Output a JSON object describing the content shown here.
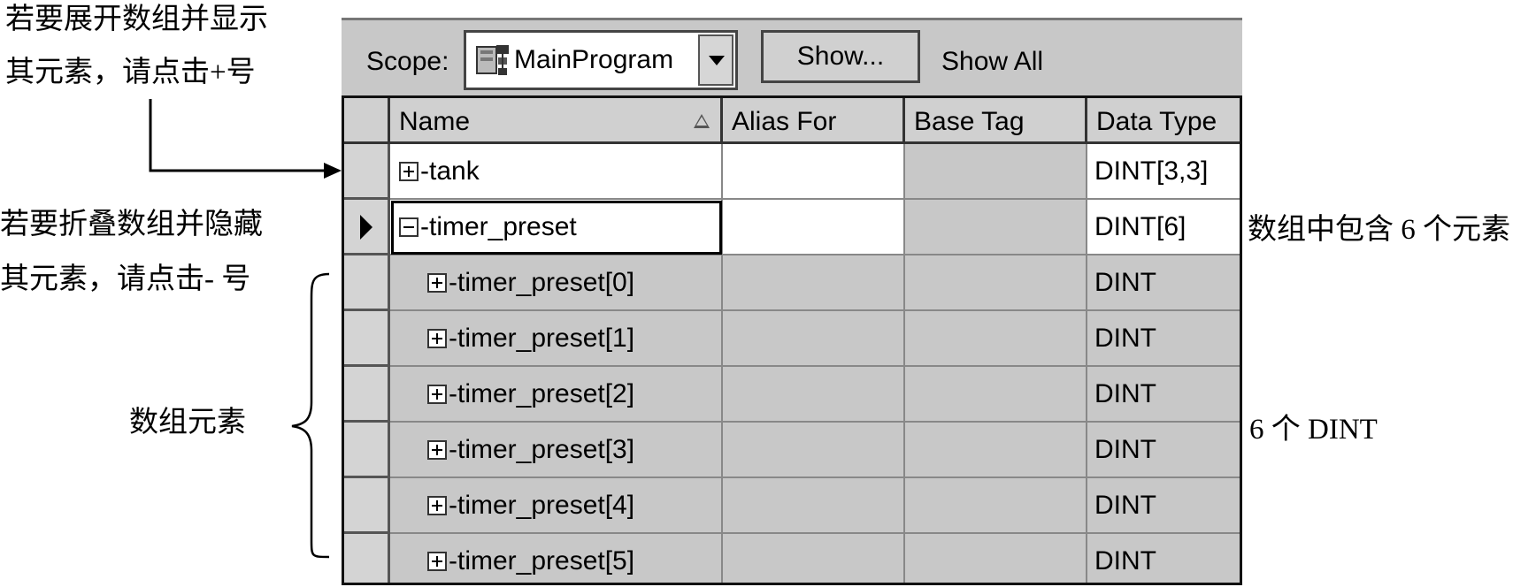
{
  "toolbar": {
    "scope_label": "Scope:",
    "scope_value": "MainProgram",
    "show_button": "Show...",
    "show_all_label": "Show All"
  },
  "columns": [
    "Name",
    "Alias For",
    "Base Tag",
    "Data Type"
  ],
  "rows": [
    {
      "name": "-tank",
      "expander": "+",
      "alias": "",
      "base": "",
      "type": "DINT[3,3]"
    },
    {
      "name": "-timer_preset",
      "expander": "-",
      "alias": "",
      "base": "",
      "type": "DINT[6]"
    },
    {
      "name": "-timer_preset[0]",
      "expander": "+",
      "alias": "",
      "base": "",
      "type": "DINT"
    },
    {
      "name": "-timer_preset[1]",
      "expander": "+",
      "alias": "",
      "base": "",
      "type": "DINT"
    },
    {
      "name": "-timer_preset[2]",
      "expander": "+",
      "alias": "",
      "base": "",
      "type": "DINT"
    },
    {
      "name": "-timer_preset[3]",
      "expander": "+",
      "alias": "",
      "base": "",
      "type": "DINT"
    },
    {
      "name": "-timer_preset[4]",
      "expander": "+",
      "alias": "",
      "base": "",
      "type": "DINT"
    },
    {
      "name": "-timer_preset[5]",
      "expander": "+",
      "alias": "",
      "base": "",
      "type": "DINT"
    }
  ],
  "annotations": {
    "expand_line1": "若要展开数组并显示",
    "expand_line2": "其元素，请点击+号",
    "collapse_line1": "若要折叠数组并隐藏",
    "collapse_line2": "其元素，请点击- 号",
    "array_elements": "数组元素",
    "contains": "数组中包含 6 个元素",
    "six_dint": "6 个 DINT"
  },
  "icons": {
    "scope": "program-icon",
    "dropdown": "chevron-down-icon",
    "sort": "sort-ascending-icon",
    "row_pointer": "current-row-icon"
  }
}
